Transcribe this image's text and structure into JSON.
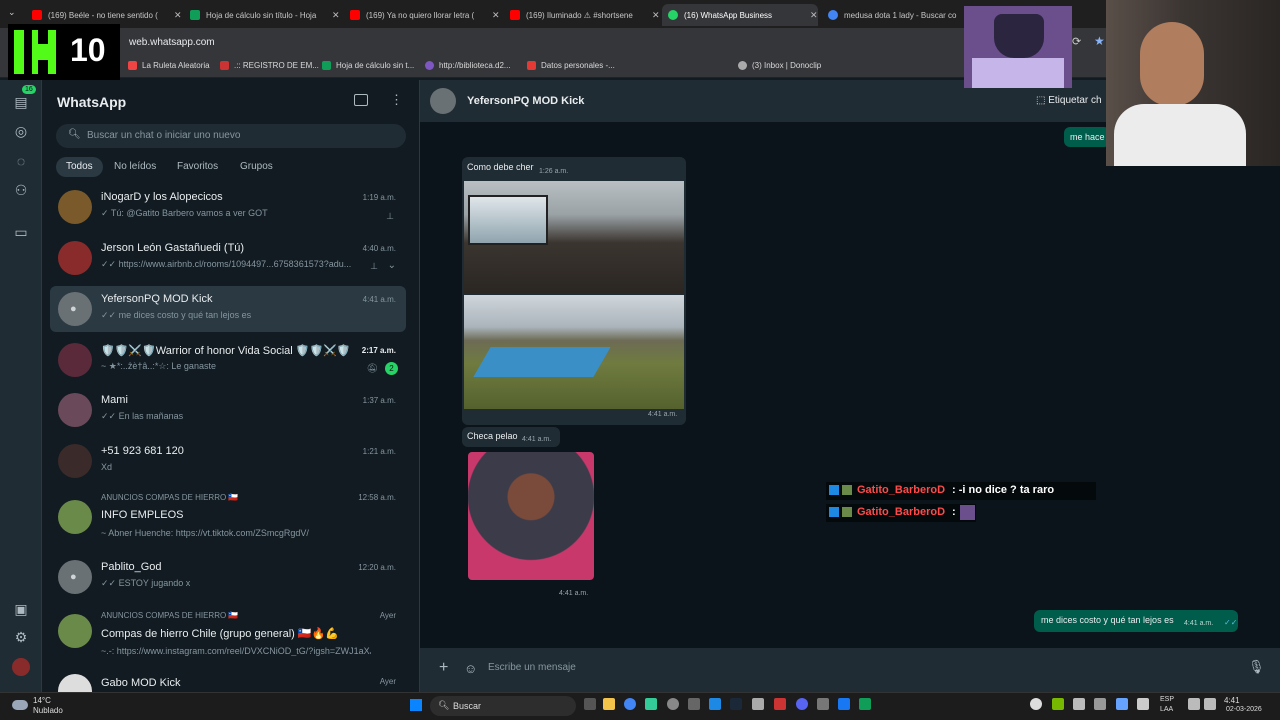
{
  "browser": {
    "tabs": [
      {
        "label": "(169) Beéle - no tiene sentido (",
        "color": "#ff0000"
      },
      {
        "label": "Hoja de cálculo sin título - Hoja",
        "color": "#0f9d58"
      },
      {
        "label": "(169) Ya no quiero llorar letra (",
        "color": "#ff0000"
      },
      {
        "label": "(169) Iluminado ⚠ #shortsene",
        "color": "#ff0000"
      },
      {
        "label": "(16) WhatsApp Business",
        "color": "#25d366"
      },
      {
        "label": "medusa dota 1 lady - Buscar co",
        "color": "#4285f4"
      }
    ],
    "url": "web.whatsapp.com",
    "bookmarks": [
      {
        "label": "La Ruleta Aleatoria",
        "color": "#e44"
      },
      {
        "label": ".:: REGISTRO DE EM...",
        "color": "#c33"
      },
      {
        "label": "Hoja de cálculo sin t...",
        "color": "#0f9d58"
      },
      {
        "label": "http://biblioteca.d2...",
        "color": "#7e57c2"
      },
      {
        "label": "Datos personales -...",
        "color": "#e53935"
      },
      {
        "label": "(3) Inbox | Donoclip",
        "color": "#aaa"
      }
    ]
  },
  "overlay": {
    "kick_number": "10",
    "kick_logo_color": "#53fc18"
  },
  "sidebar": {
    "title": "WhatsApp",
    "unread_badge": "16",
    "search_placeholder": "Buscar un chat o iniciar uno nuevo",
    "filters": [
      "Todos",
      "No leídos",
      "Favoritos",
      "Grupos"
    ]
  },
  "chats": [
    {
      "name": "iNogarD y los Alopecicos",
      "preview": "✓ Tú: @Gatito Barbero vamos a ver GOT",
      "time": "1:19 a.m.",
      "avatar": "#7a5a2a"
    },
    {
      "name": "Jerson León Gastañuedi (Tú)",
      "preview": "✓✓ https://www.airbnb.cl/rooms/1094497...6758361573?adu...",
      "time": "4:40 a.m.",
      "avatar": "#8a2b2b"
    },
    {
      "name": "YefersonPQ MOD Kick",
      "preview": "✓✓ me dices costo y qué tan lejos es",
      "time": "4:41 a.m.",
      "avatar": "#6a7175"
    },
    {
      "name": "🛡️🛡️⚔️🛡️Warrior of honor Vida Social 🛡️🛡️⚔️🛡️",
      "preview": "~ ★*:..ẑè†â..:*☆: Le ganaste",
      "time": "2:17 a.m.",
      "avatar": "#5a2a3a",
      "unread": "2"
    },
    {
      "name": "Mami",
      "preview": "✓✓ En las mañanas",
      "time": "1:37 a.m.",
      "avatar": "#6a4a5a"
    },
    {
      "name": "+51 923 681 120",
      "preview": "Xd",
      "time": "1:21 a.m.",
      "avatar": "#3a2a2a"
    },
    {
      "name": "INFO EMPLEOS",
      "group": "ANUNCIOS COMPAS DE HIERRO 🇨🇱",
      "preview": "~ Abner Huenche: https://vt.tiktok.com/ZSmcgRgdV/",
      "time": "12:58 a.m.",
      "avatar": "#6a8a4a"
    },
    {
      "name": "Pablito_God",
      "preview": "✓✓ ESTOY jugando x",
      "time": "12:20 a.m.",
      "avatar": "#6a7175"
    },
    {
      "name": "Compas de hierro Chile (grupo general) 🇨🇱🔥💪",
      "group": "ANUNCIOS COMPAS DE HIERRO 🇨🇱",
      "preview": "~.-: https://www.instagram.com/reel/DVXCNiOD_tG/?igsh=ZWJ1aXJ...",
      "time": "Ayer",
      "avatar": "#6a8a4a"
    },
    {
      "name": "Gabo MOD Kick",
      "preview": "",
      "time": "Ayer",
      "avatar": "#ddd"
    }
  ],
  "conversation": {
    "contact": "YefersonPQ MOD Kick",
    "label_button": "Etiquetar ch",
    "messages": {
      "m1_text": "Como debe cher",
      "m1_time": "1:26 a.m.",
      "img_time": "4:41 a.m.",
      "m2_text": "Checa pelao",
      "m2_time": "4:41 a.m.",
      "sticker_time": "4:41 a.m.",
      "out_partial": "me hace",
      "out_text": "me dices costo y qué tan lejos es",
      "out_time": "4:41 a.m."
    },
    "composer_placeholder": "Escribe un mensaje"
  },
  "stream_chat": [
    {
      "user": "Gatito_BarberoD",
      "text": ": -i no dice ? ta raro"
    },
    {
      "user": "Gatito_BarberoD",
      "text": ":"
    }
  ],
  "taskbar": {
    "weather_temp": "14°C",
    "weather_desc": "Nublado",
    "search": "Buscar",
    "lang1": "ESP",
    "lang2": "LAA",
    "clock_time": "4:41",
    "clock_date": "02-03-2026"
  }
}
